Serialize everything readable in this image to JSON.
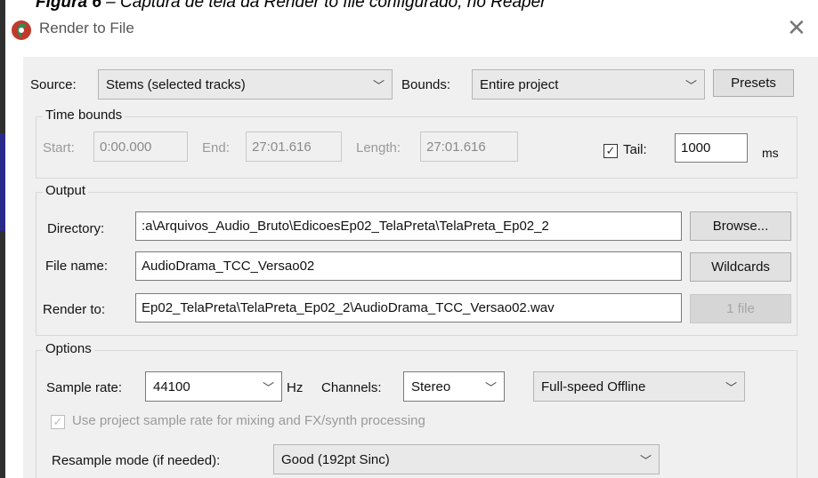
{
  "caption": {
    "prefix": "Figura 6",
    "text": " – Captura de tela da Render to file configurado, no Reaper"
  },
  "window": {
    "title": "Render to File"
  },
  "source": {
    "label": "Source:",
    "value": "Stems (selected tracks)"
  },
  "bounds": {
    "label": "Bounds:",
    "value": "Entire project"
  },
  "presets": {
    "label": "Presets"
  },
  "time_bounds": {
    "title": "Time bounds",
    "start_label": "Start:",
    "start_value": "0:00.000",
    "end_label": "End:",
    "end_value": "27:01.616",
    "length_label": "Length:",
    "length_value": "27:01.616",
    "tail_label": "Tail:",
    "tail_value": "1000",
    "tail_unit": "ms",
    "tail_checked": "✓"
  },
  "output": {
    "title": "Output",
    "directory_label": "Directory:",
    "directory_value": ":a\\Arquivos_Audio_Bruto\\EdicoesEp02_TelaPreta\\TelaPreta_Ep02_2",
    "browse_label": "Browse...",
    "filename_label": "File name:",
    "filename_value": "AudioDrama_TCC_Versao02",
    "wildcards_label": "Wildcards",
    "renderto_label": "Render to:",
    "renderto_value": "Ep02_TelaPreta\\TelaPreta_Ep02_2\\AudioDrama_TCC_Versao02.wav",
    "files_label": "1 file"
  },
  "options": {
    "title": "Options",
    "samplerate_label": "Sample rate:",
    "samplerate_value": "44100",
    "hz_label": "Hz",
    "channels_label": "Channels:",
    "channels_value": "Stereo",
    "mode_value": "Full-speed Offline",
    "project_rate_label": "Use project sample rate for mixing and FX/synth processing",
    "project_rate_checked": "✓",
    "resample_label": "Resample mode (if needed):",
    "resample_value": "Good (192pt Sinc)"
  },
  "colors": {
    "dialog_bg": "#f0f0f0",
    "disabled_text": "#9a9a9a",
    "logo_red": "#c0392b",
    "logo_green": "#2e8b57"
  }
}
